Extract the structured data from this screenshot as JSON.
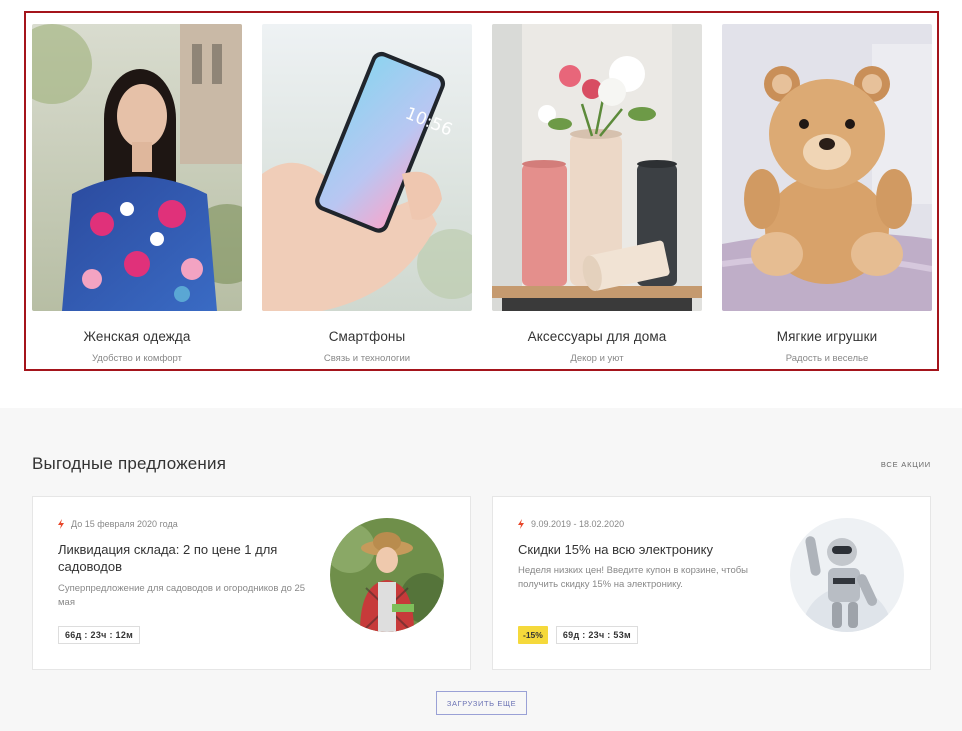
{
  "categories": [
    {
      "name": "Женская одежда",
      "subtitle": "Удобство и комфорт"
    },
    {
      "name": "Смартфоны",
      "subtitle": "Связь и технологии",
      "phone_time": "10:56"
    },
    {
      "name": "Аксессуары для дома",
      "subtitle": "Декор и уют"
    },
    {
      "name": "Мягкие игрушки",
      "subtitle": "Радость и веселье"
    }
  ],
  "offers_section": {
    "title": "Выгодные предложения",
    "all_link": "Все акции",
    "load_more": "Загрузить еще"
  },
  "offers": [
    {
      "date": "До 15 февраля 2020 года",
      "title": "Ликвидация склада: 2 по цене 1 для садоводов",
      "description": "Суперпредложение для садоводов и огородников до 25 мая",
      "timer": "66д : 23ч : 12м",
      "discount": null
    },
    {
      "date": "9.09.2019 - 18.02.2020",
      "title": "Скидки 15% на всю электронику",
      "description": "Неделя низких цен! Введите купон в корзине, чтобы получить скидку 15% на электронику.",
      "timer": "69д : 23ч : 53м",
      "discount": "-15%"
    }
  ],
  "colors": {
    "highlight_border": "#a4141b",
    "bolt": "#e8472a",
    "discount_badge": "#f5d93b",
    "load_more": "#6b73b5"
  },
  "icons": {
    "offer_marker": "lightning-icon"
  }
}
